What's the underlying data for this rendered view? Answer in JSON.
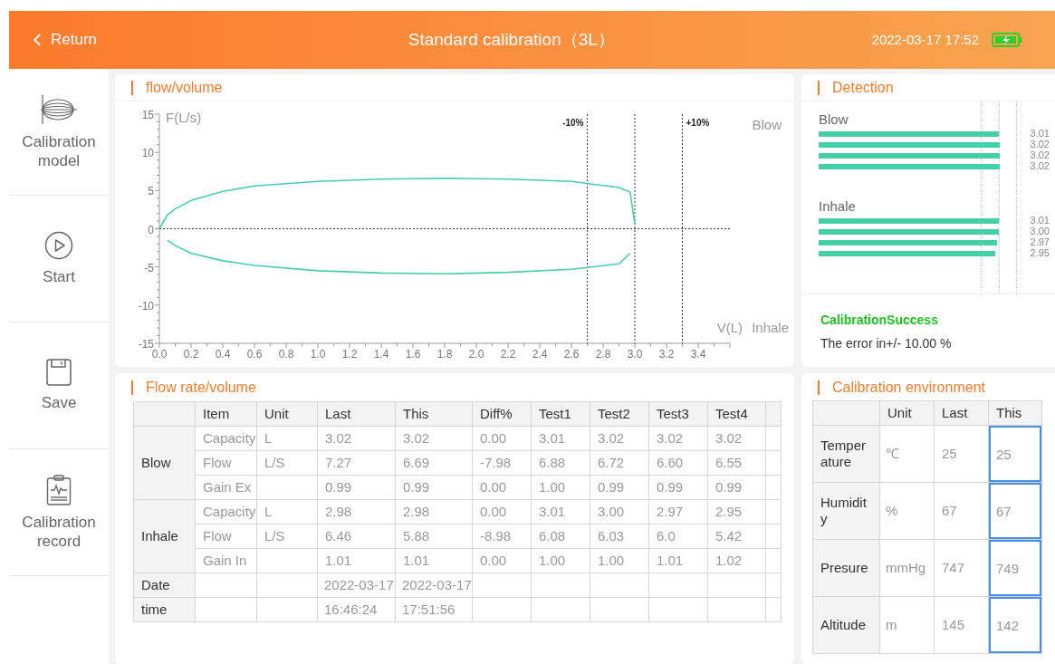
{
  "header": {
    "back": "Return",
    "title": "Standard calibration（3L）",
    "datetime": "2022-03-17 17:52"
  },
  "sidebar": {
    "items": [
      {
        "kind": "model",
        "label": "Calibration model"
      },
      {
        "kind": "start",
        "label": "Start"
      },
      {
        "kind": "save",
        "label": "Save"
      },
      {
        "kind": "record",
        "label": "Calibration record"
      }
    ]
  },
  "flow_volume": {
    "title": "flow/volume",
    "chart_data": {
      "type": "line",
      "xlabel": "V(L)",
      "ylabel": "F(L/s)",
      "x": [
        0,
        0.05,
        0.1,
        0.2,
        0.4,
        0.6,
        1.0,
        1.4,
        1.8,
        2.2,
        2.6,
        2.9,
        2.97,
        3.0
      ],
      "series": [
        {
          "name": "Blow",
          "color": "#45d0a8",
          "values": [
            0,
            1.8,
            2.6,
            3.7,
            4.9,
            5.6,
            6.2,
            6.5,
            6.6,
            6.5,
            6.2,
            5.4,
            4.8,
            0.6
          ]
        },
        {
          "name": "Inhale",
          "color": "#45d0a8",
          "values": [
            null,
            -1.5,
            -2.2,
            -3.2,
            -4.2,
            -4.8,
            -5.5,
            -5.8,
            -5.9,
            -5.7,
            -5.3,
            -4.6,
            -3.2,
            null
          ]
        }
      ],
      "xlim": [
        0,
        3.6
      ],
      "ylim": [
        -15,
        15
      ],
      "xticks": [
        {
          "value": 0,
          "label": "0.0"
        },
        {
          "value": 0.2,
          "label": "0.2"
        },
        {
          "value": 0.4,
          "label": "0.4"
        },
        {
          "value": 0.6,
          "label": "0.6"
        },
        {
          "value": 0.8,
          "label": "0.8"
        },
        {
          "value": 1,
          "label": "1.0"
        },
        {
          "value": 1.2,
          "label": "1.2"
        },
        {
          "value": 1.4,
          "label": "1.4"
        },
        {
          "value": 1.6,
          "label": "1.6"
        },
        {
          "value": 1.8,
          "label": "1.8"
        },
        {
          "value": 2,
          "label": "2.0"
        },
        {
          "value": 2.2,
          "label": "2.2"
        },
        {
          "value": 2.4,
          "label": "2.4"
        },
        {
          "value": 2.6,
          "label": "2.6"
        },
        {
          "value": 2.8,
          "label": "2.8"
        },
        {
          "value": 3,
          "label": "3.0"
        },
        {
          "value": 3.2,
          "label": "3.2"
        },
        {
          "value": 3.4,
          "label": "3.4"
        }
      ],
      "yticks": [
        -15,
        -10,
        -5,
        0,
        5,
        10,
        15
      ]
    },
    "limit_labels": [
      "-10%",
      "+10%"
    ]
  },
  "detection": {
    "title": "Detection",
    "groups": [
      {
        "label": "Blow",
        "bars": [
          {
            "reading": "3.01"
          },
          {
            "reading": "3.02"
          },
          {
            "reading": "3.02"
          },
          {
            "reading": "3.02"
          }
        ]
      },
      {
        "label": "Inhale",
        "bars": [
          {
            "reading": "3.01"
          },
          {
            "reading": "3.00"
          },
          {
            "reading": "2.97"
          },
          {
            "reading": "2.95"
          }
        ]
      }
    ],
    "status": {
      "kind": "success",
      "text": "CalibrationSuccess"
    },
    "message": "The error in+/- 10.00 %"
  },
  "flow_table": {
    "title": "Flow rate/volume",
    "columns": [
      "Item",
      "Unit",
      "Last",
      "This",
      "Diff%",
      "Test1",
      "Test2",
      "Test3",
      "Test4"
    ],
    "groups": [
      {
        "label": "Blow",
        "rows": [
          {
            "item": "Capacity",
            "unit": "L",
            "values": [
              "3.02",
              "3.02",
              "0.00",
              "3.01",
              "3.02",
              "3.02",
              "3.02"
            ]
          },
          {
            "item": "Flow",
            "unit": "L/S",
            "values": [
              "7.27",
              "6.69",
              "-7.98",
              "6.88",
              "6.72",
              "6.60",
              "6.55"
            ]
          },
          {
            "item": "Gain Ex",
            "values": [
              "0.99",
              "0.99",
              "0.00",
              "1.00",
              "0.99",
              "0.99",
              "0.99"
            ]
          }
        ]
      },
      {
        "label": "Inhale",
        "rows": [
          {
            "item": "Capacity",
            "unit": "L",
            "values": [
              "2.98",
              "2.98",
              "0.00",
              "3.01",
              "3.00",
              "2.97",
              "2.95"
            ]
          },
          {
            "item": "Flow",
            "unit": "L/S",
            "values": [
              "6.46",
              "5.88",
              "-8.98",
              "6.08",
              "6.03",
              "6.0",
              "5.42"
            ]
          },
          {
            "item": "Gain In",
            "values": [
              "1.01",
              "1.01",
              "0.00",
              "1.00",
              "1.00",
              "1.01",
              "1.02"
            ]
          }
        ]
      }
    ],
    "footer_rows": [
      {
        "label": "Date",
        "last": "2022-03-17",
        "this": "2022-03-17"
      },
      {
        "label": "time",
        "last": "16:46:24",
        "this": "17:51:56"
      }
    ]
  },
  "environment": {
    "title": "Calibration environment",
    "columns": [
      "Unit",
      "Last",
      "This"
    ],
    "rows": [
      {
        "label": "Temperature",
        "unit": "℃",
        "last": "25",
        "this": "25"
      },
      {
        "label": "Humidity",
        "unit": "%",
        "last": "67",
        "this": "67"
      },
      {
        "label": "Presure",
        "unit": "mmHg",
        "last": "747",
        "this": "749"
      },
      {
        "label": "Altitude",
        "unit": "m",
        "last": "145",
        "this": "142"
      }
    ]
  }
}
